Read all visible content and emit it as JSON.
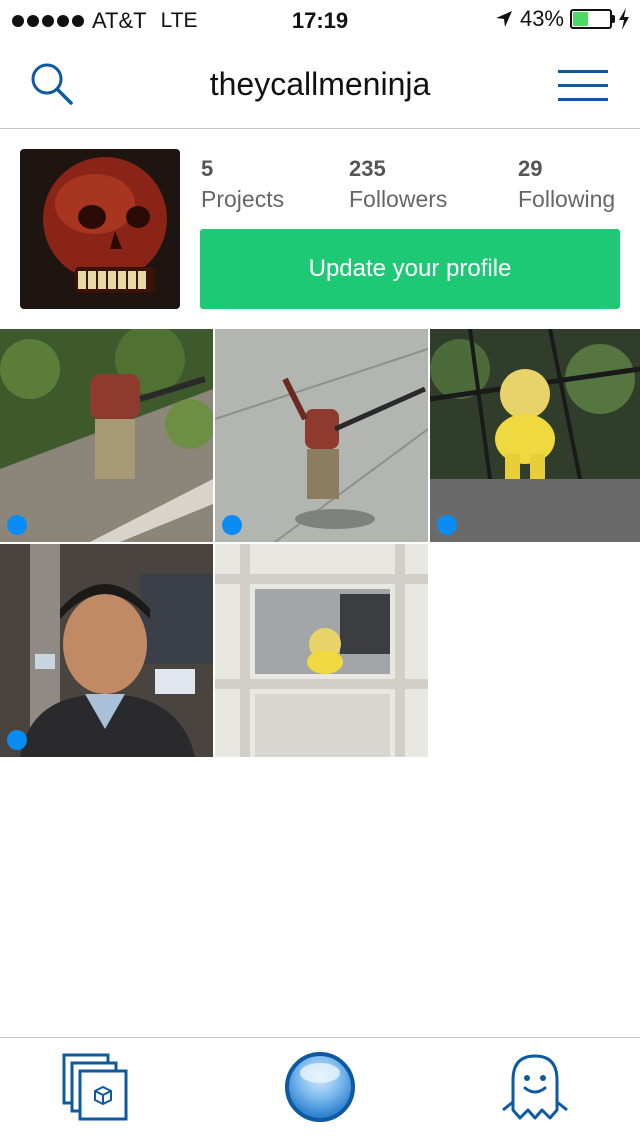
{
  "status_bar": {
    "carrier": "AT&T",
    "network": "LTE",
    "time": "17:19",
    "battery": "43%"
  },
  "header": {
    "title": "theycallmeninja",
    "left_icon": "search-icon",
    "right_icon": "menu-icon"
  },
  "profile": {
    "stats": [
      {
        "value": "5",
        "label": "Projects"
      },
      {
        "value": "235",
        "label": "Followers"
      },
      {
        "value": "29",
        "label": "Following"
      }
    ],
    "update_button": "Update your profile"
  },
  "projects": [
    {
      "subject": "red skull figure in bushes",
      "badge": true
    },
    {
      "subject": "red skull figure on sidewalk",
      "badge": true
    },
    {
      "subject": "yellow doll figure by fence",
      "badge": true
    },
    {
      "subject": "portrait in office",
      "badge": true
    },
    {
      "subject": "yellow doll on shelf",
      "badge": false
    }
  ],
  "tab_bar": {
    "items": [
      "projects-stack-icon",
      "capture-orb-icon",
      "ghost-profile-icon"
    ]
  },
  "colors": {
    "accent_blue": "#0d5aa0",
    "update_green": "#1ec874",
    "badge_blue": "#0a8cf5"
  }
}
